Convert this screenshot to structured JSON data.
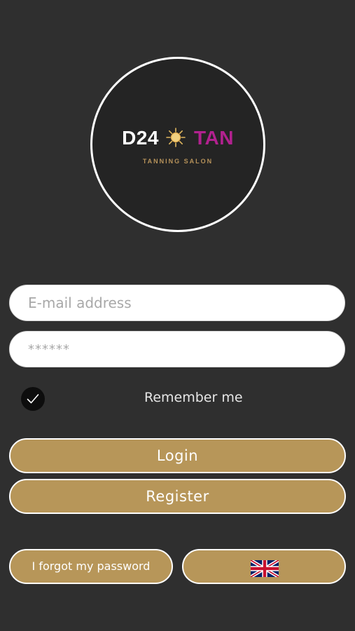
{
  "logo": {
    "brand_left": "D24",
    "brand_right": "TAN",
    "tagline": "TANNING SALON",
    "icon": "sun-icon"
  },
  "form": {
    "email_placeholder": "E-mail address",
    "password_placeholder": "******",
    "remember_label": "Remember me",
    "remember_checked": true
  },
  "actions": {
    "login_label": "Login",
    "register_label": "Register",
    "forgot_label": "I forgot my password",
    "language_icon": "uk-flag-icon"
  },
  "colors": {
    "background": "#2f2f2f",
    "button_gold": "#b79659",
    "brand_magenta": "#b2218f",
    "tagline_gold": "#b6925a"
  }
}
